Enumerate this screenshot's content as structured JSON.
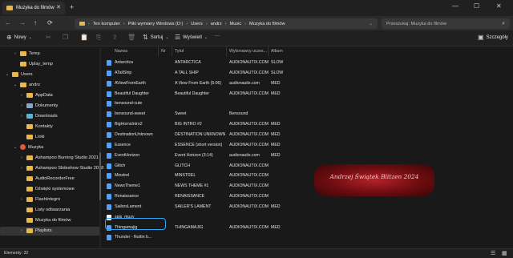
{
  "window": {
    "tab_title": "Muzyka do filmów",
    "new_tab": "+",
    "minimize": "—",
    "maximize": "☐",
    "close": "✕"
  },
  "address": {
    "crumbs": [
      "Ten komputer",
      "Pliki wymiany Windows (D:)",
      "Users",
      "andrz",
      "Music",
      "Muzyka do filmów"
    ],
    "search_placeholder": "Przeszukaj: Muzyka do filmów"
  },
  "toolbar": {
    "new_label": "Nowy",
    "sort_label": "Sortuj",
    "view_label": "Wyświetl",
    "more_label": "···",
    "details_label": "Szczegóły"
  },
  "sidebar": {
    "items": [
      {
        "label": "Temp",
        "chevron": "›",
        "icon": "folder"
      },
      {
        "label": "Uplay_temp",
        "chevron": "",
        "icon": "folder"
      },
      {
        "label": "Users",
        "chevron": "⌄",
        "icon": "folder"
      },
      {
        "label": "andrz",
        "chevron": "⌄",
        "icon": "folder"
      },
      {
        "label": "AppData",
        "chevron": "›",
        "icon": "folder"
      },
      {
        "label": "Dokumenty",
        "chevron": "›",
        "icon": "documents"
      },
      {
        "label": "Downloads",
        "chevron": "›",
        "icon": "downloads"
      },
      {
        "label": "Kontakty",
        "chevron": "",
        "icon": "folder"
      },
      {
        "label": "Linki",
        "chevron": "",
        "icon": "folder"
      },
      {
        "label": "Muzyka",
        "chevron": "⌄",
        "icon": "music"
      },
      {
        "label": "Ashampoo Burning Studio 2021",
        "chevron": "›",
        "icon": "folder"
      },
      {
        "label": "Ashampoo Slideshow Studio 2018",
        "chevron": "›",
        "icon": "folder"
      },
      {
        "label": "AudioRecorderFree",
        "chevron": "",
        "icon": "folder"
      },
      {
        "label": "Dźwięki systemowe",
        "chevron": "",
        "icon": "folder"
      },
      {
        "label": "FlashIntegro",
        "chevron": "›",
        "icon": "folder"
      },
      {
        "label": "Listy odtwarzania",
        "chevron": "",
        "icon": "folder"
      },
      {
        "label": "Muzyka do filmów",
        "chevron": "",
        "icon": "folder",
        "selected": true
      },
      {
        "label": "Playlists",
        "chevron": "›",
        "icon": "folder"
      }
    ]
  },
  "columns": [
    "Nazwa",
    "Nr",
    "Tytuł",
    "Wykonawcy uczes...",
    "Album"
  ],
  "files": [
    {
      "name": "Antarctica",
      "nr": "",
      "title": "ANTARCTICA",
      "artist": "AUDIONAUTIX.COM",
      "album": "SLOW",
      "type": "audio"
    },
    {
      "name": "ATallShip",
      "nr": "",
      "title": "A TALL SHIP",
      "artist": "AUDIONAUTIX.COM",
      "album": "SLOW",
      "type": "audio"
    },
    {
      "name": "AViewFromEarth",
      "nr": "",
      "title": "A View From Earth (5:06)",
      "artist": "audionautix.com",
      "album": "MED",
      "type": "audio"
    },
    {
      "name": "Beautiful Daughter",
      "nr": "",
      "title": "Beautiful Daughter",
      "artist": "AUDIONAUTIX.COM",
      "album": "MED",
      "type": "audio"
    },
    {
      "name": "bensound-cute",
      "nr": "",
      "title": "",
      "artist": "",
      "album": "",
      "type": "audio"
    },
    {
      "name": "bensound-sweet",
      "nr": "",
      "title": "Sweet",
      "artist": "Bensound",
      "album": "",
      "type": "audio"
    },
    {
      "name": "BigHornsIntro2",
      "nr": "",
      "title": "BIG INTRO #2",
      "artist": "AUDIONAUTIX.COM",
      "album": "MED",
      "type": "audio"
    },
    {
      "name": "DestinationUnknown",
      "nr": "",
      "title": "DESTINATION UNKNOWN",
      "artist": "AUDIONAUTIX.COM",
      "album": "MED",
      "type": "audio"
    },
    {
      "name": "Essence",
      "nr": "",
      "title": "ESSENCE (short version)",
      "artist": "AUDIONAUTIX.COM",
      "album": "MED",
      "type": "audio"
    },
    {
      "name": "EventHorizon",
      "nr": "",
      "title": "Event Horizon (3:14)",
      "artist": "audionautix.com",
      "album": "MED",
      "type": "audio"
    },
    {
      "name": "Glitch",
      "nr": "",
      "title": "GLITCH",
      "artist": "AUDIONAUTIX.COM",
      "album": "",
      "type": "audio"
    },
    {
      "name": "Minstrel",
      "nr": "",
      "title": "MINSTREL",
      "artist": "AUDIONAUTIX.COM",
      "album": "",
      "type": "audio"
    },
    {
      "name": "NewsTheme1",
      "nr": "",
      "title": "NEWS THEME #1",
      "artist": "AUDIONAUTIX.COM",
      "album": "",
      "type": "audio"
    },
    {
      "name": "Renaissance",
      "nr": "",
      "title": "RENAISSANCE",
      "artist": "AUDIONAUTIX.COM",
      "album": "",
      "type": "audio"
    },
    {
      "name": "SailorsLament",
      "nr": "",
      "title": "SAILER'S LAMENT",
      "artist": "AUDIONAUTIX.COM",
      "album": "MED",
      "type": "audio"
    },
    {
      "name": "spis_muzy",
      "nr": "",
      "title": "",
      "artist": "",
      "album": "",
      "type": "text",
      "highlighted": true
    },
    {
      "name": "Thingamajig",
      "nr": "",
      "title": "THINGAMAJIG",
      "artist": "AUDIONAUTIX.COM",
      "album": "MED",
      "type": "audio"
    },
    {
      "name": "Thunder - Nuttin b...",
      "nr": "",
      "title": "",
      "artist": "",
      "album": "",
      "type": "audio"
    }
  ],
  "watermark": "Andrzej Świątek Blitzen 2024",
  "status": {
    "count_text": "Elementy: 32",
    "view_details_icon": "☰",
    "view_tiles_icon": "▦"
  },
  "colors": {
    "accent": "#2ea3f2",
    "folder": "#e8b84a",
    "watermark": "#8b1118"
  }
}
